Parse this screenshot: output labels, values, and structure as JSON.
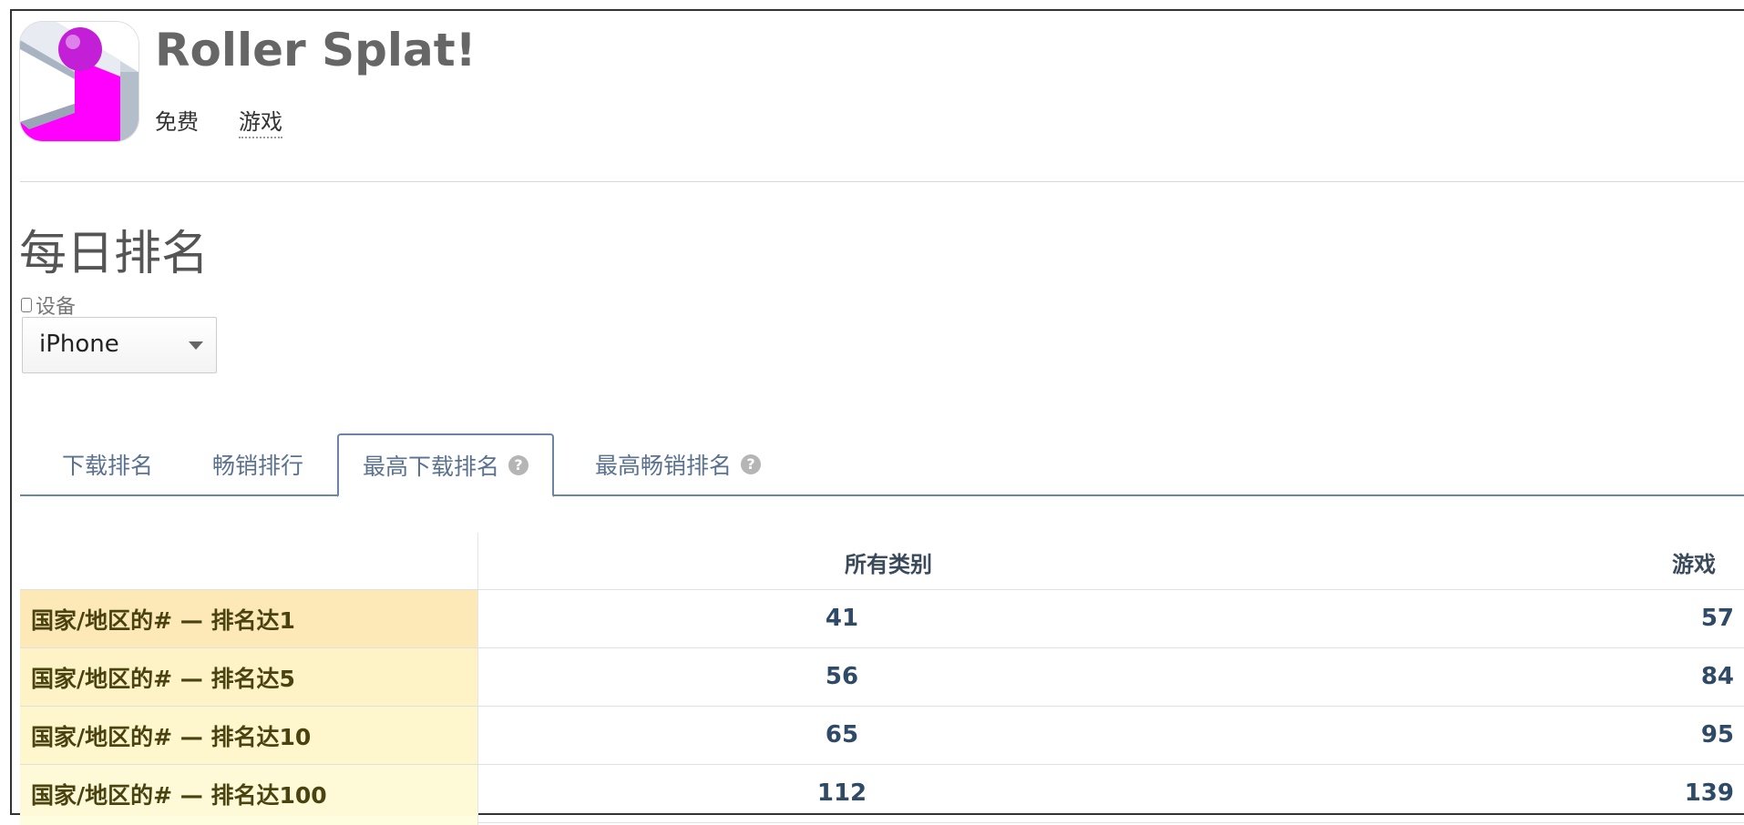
{
  "app": {
    "title": "Roller Splat!",
    "price": "免费",
    "category": "游戏",
    "icon": "roller-splat-app-icon"
  },
  "section": {
    "title": "每日排名"
  },
  "device": {
    "label": "设备",
    "selected": "iPhone"
  },
  "tabs": [
    {
      "label": "下载排名",
      "active": false
    },
    {
      "label": "畅销排行",
      "active": false
    },
    {
      "label": "最高下载排名",
      "active": true,
      "help": "?"
    },
    {
      "label": "最高畅销排名",
      "active": false,
      "help": "?"
    }
  ],
  "table": {
    "columns": [
      "",
      "所有类别",
      "游戏"
    ],
    "rows": [
      {
        "label": "国家/地区的# — 排名达1",
        "all": "41",
        "games": "57",
        "color": "#fde9b8"
      },
      {
        "label": "国家/地区的# — 排名达5",
        "all": "56",
        "games": "84",
        "color": "#fdf3c6"
      },
      {
        "label": "国家/地区的# — 排名达10",
        "all": "65",
        "games": "95",
        "color": "#fef6cc"
      },
      {
        "label": "国家/地区的# — 排名达100",
        "all": "112",
        "games": "139",
        "color": "#fefad8"
      }
    ]
  },
  "colors": {
    "tab_text": "#5a7290",
    "value_text": "#2e4a66",
    "label_text": "#4a4310",
    "icon_magenta": "#ff00ff"
  }
}
